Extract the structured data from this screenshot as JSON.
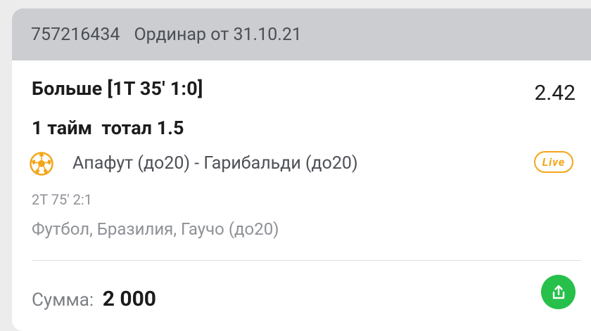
{
  "bet": {
    "id": "757216434",
    "type": "Ординар от 31.10.21",
    "market": "Больше [1Т 35' 1:0]",
    "odds": "2.42",
    "selection": "1 тайм  тотал 1.5",
    "match": "Апафут (до20) - Гарибальди (до20)",
    "live_label": "Live",
    "score": "2Т 75' 2:1",
    "tournament": "Футбол, Бразилия, Гаучо (до20)",
    "sum_label": "Сумма:",
    "sum_value": "2 000"
  },
  "colors": {
    "header_bg": "#cbcdd1",
    "live": "#f2a61a",
    "share_button": "#27c04b",
    "ball": "#f2a61a"
  },
  "icons": {
    "sport": "soccer-ball-icon",
    "share": "share-icon"
  }
}
